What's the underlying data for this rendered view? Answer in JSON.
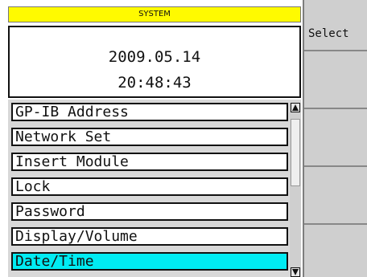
{
  "header": {
    "title": "SYSTEM"
  },
  "clock": {
    "date": "2009.05.14",
    "time": "20:48:43"
  },
  "menu": {
    "items": [
      {
        "label": "GP-IB Address",
        "selected": false
      },
      {
        "label": "Network Set",
        "selected": false
      },
      {
        "label": "Insert Module",
        "selected": false
      },
      {
        "label": "Lock",
        "selected": false
      },
      {
        "label": "Password",
        "selected": false
      },
      {
        "label": "Display/Volume",
        "selected": false
      },
      {
        "label": "Date/Time",
        "selected": true
      }
    ],
    "scroll_up_icon": "triangle-up-icon",
    "scroll_down_icon": "triangle-down-icon"
  },
  "softkeys": [
    {
      "label": "Select"
    },
    {
      "label": ""
    },
    {
      "label": ""
    },
    {
      "label": ""
    },
    {
      "label": ""
    }
  ],
  "colors": {
    "title_bar": "#fffa00",
    "selected_item": "#00ecf3",
    "softkey_panel": "#cfcfcf"
  }
}
